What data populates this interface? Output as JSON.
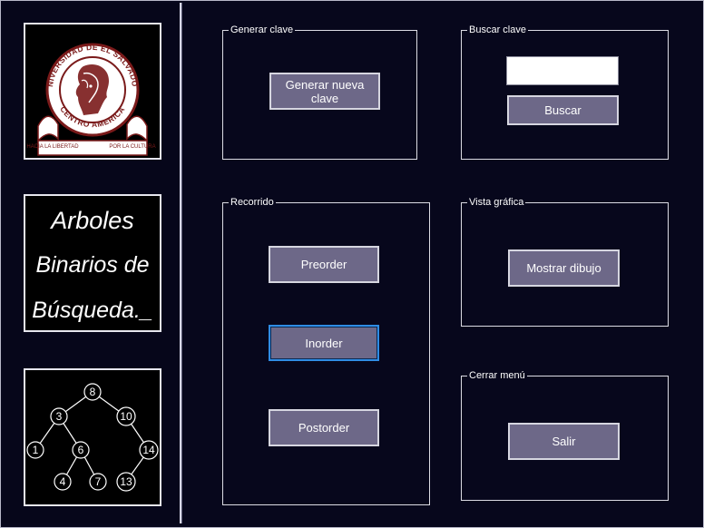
{
  "logo": {
    "ring_top": "UNIVERSIDAD DE EL SALVADOR",
    "ring_bottom": "CENTRO AMERICA",
    "ribbon_left": "HACIA LA LIBERTAD",
    "ribbon_right": "POR LA CULTURA"
  },
  "title_image": {
    "line1": "Arboles",
    "line2": "Binarios de",
    "line3": "Búsqueda._"
  },
  "tree_image": {
    "nodes": [
      "8",
      "3",
      "10",
      "1",
      "6",
      "14",
      "4",
      "7",
      "13"
    ]
  },
  "groups": {
    "generar": {
      "label": "Generar clave",
      "button": "Generar nueva clave"
    },
    "buscar": {
      "label": "Buscar clave",
      "input_value": "",
      "button": "Buscar"
    },
    "recorrido": {
      "label": "Recorrido",
      "preorder": "Preorder",
      "inorder": "Inorder",
      "postorder": "Postorder"
    },
    "vista": {
      "label": "Vista gráfica",
      "button": "Mostrar dibujo"
    },
    "cerrar": {
      "label": "Cerrar menú",
      "button": "Salir"
    }
  },
  "colors": {
    "background": "#07071c",
    "button_face": "#6d6888",
    "focus_border": "#2f8ce4",
    "logo_red": "#7a1a1a"
  }
}
